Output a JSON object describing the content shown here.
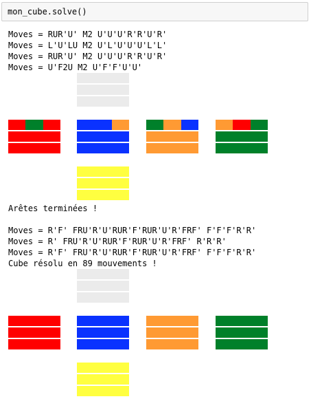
{
  "cell": {
    "code": "mon_cube.solve()"
  },
  "colors": {
    "W": "#ebebeb",
    "R": "#ff0000",
    "G": "#00802a",
    "B": "#0a32ff",
    "O": "#ff9a33",
    "Y": "#ffff40"
  },
  "blocks": [
    {
      "type": "text",
      "lines": [
        "Moves = RUR'U' M2 U'U'U'R'R'U'R'",
        "Moves = L'U'LU M2 U'L'U'U'U'L'L'",
        "Moves = RUR'U' M2 U'U'U'R'R'U'R'",
        "Moves = U'F2U M2 U'F'F'U'U'"
      ]
    },
    {
      "type": "cube",
      "top": [
        [
          "W",
          "W",
          "W"
        ],
        [
          "W",
          "W",
          "W"
        ],
        [
          "W",
          "W",
          "W"
        ]
      ],
      "front": [
        [
          "R",
          "G",
          "R"
        ],
        [
          "R",
          "R",
          "R"
        ],
        [
          "R",
          "R",
          "R"
        ]
      ],
      "right": [
        [
          "B",
          "B",
          "O"
        ],
        [
          "B",
          "B",
          "B"
        ],
        [
          "B",
          "B",
          "B"
        ]
      ],
      "back": [
        [
          "G",
          "O",
          "B"
        ],
        [
          "O",
          "O",
          "O"
        ],
        [
          "O",
          "O",
          "O"
        ]
      ],
      "left": [
        [
          "O",
          "R",
          "G"
        ],
        [
          "G",
          "G",
          "G"
        ],
        [
          "G",
          "G",
          "G"
        ]
      ],
      "bottom": [
        [
          "Y",
          "Y",
          "Y"
        ],
        [
          "Y",
          "Y",
          "Y"
        ],
        [
          "Y",
          "Y",
          "Y"
        ]
      ]
    },
    {
      "type": "text",
      "lines": [
        "Arêtes terminées !",
        "",
        "Moves = R'F' FRU'R'U'RUR'F'RUR'U'R'FRF' F'F'F'R'R'",
        "Moves = R' FRU'R'U'RUR'F'RUR'U'R'FRF' R'R'R'",
        "Moves = R'F' FRU'R'U'RUR'F'RUR'U'R'FRF' F'F'F'R'R'",
        "Cube résolu en 89 mouvements !"
      ]
    },
    {
      "type": "cube",
      "top": [
        [
          "W",
          "W",
          "W"
        ],
        [
          "W",
          "W",
          "W"
        ],
        [
          "W",
          "W",
          "W"
        ]
      ],
      "front": [
        [
          "R",
          "R",
          "R"
        ],
        [
          "R",
          "R",
          "R"
        ],
        [
          "R",
          "R",
          "R"
        ]
      ],
      "right": [
        [
          "B",
          "B",
          "B"
        ],
        [
          "B",
          "B",
          "B"
        ],
        [
          "B",
          "B",
          "B"
        ]
      ],
      "back": [
        [
          "O",
          "O",
          "O"
        ],
        [
          "O",
          "O",
          "O"
        ],
        [
          "O",
          "O",
          "O"
        ]
      ],
      "left": [
        [
          "G",
          "G",
          "G"
        ],
        [
          "G",
          "G",
          "G"
        ],
        [
          "G",
          "G",
          "G"
        ]
      ],
      "bottom": [
        [
          "Y",
          "Y",
          "Y"
        ],
        [
          "Y",
          "Y",
          "Y"
        ],
        [
          "Y",
          "Y",
          "Y"
        ]
      ]
    }
  ]
}
